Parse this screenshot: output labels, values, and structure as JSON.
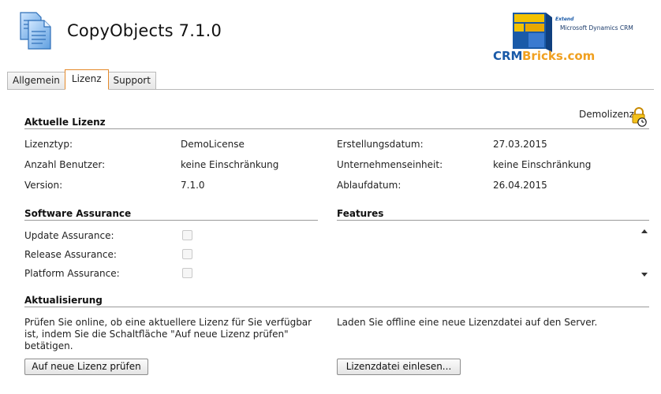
{
  "app": {
    "title": "CopyObjects 7.1.0",
    "icon": "document-copy-icon"
  },
  "brand": {
    "extend": "Extend",
    "product": "Microsoft Dynamics CRM",
    "name_a": "CRM",
    "name_b": "Bricks.com"
  },
  "tabs": [
    {
      "label": "Allgemein",
      "active": false
    },
    {
      "label": "Lizenz",
      "active": true
    },
    {
      "label": "Support",
      "active": false
    }
  ],
  "license": {
    "badge": "Demolizenz",
    "title": "Aktuelle Lizenz",
    "rows": [
      {
        "label": "Lizenztyp:",
        "value": "DemoLicense",
        "label2": "Erstellungsdatum:",
        "value2": "27.03.2015"
      },
      {
        "label": "Anzahl Benutzer:",
        "value": "keine Einschränkung",
        "label2": "Unternehmenseinheit:",
        "value2": "keine Einschränkung"
      },
      {
        "label": "Version:",
        "value": "7.1.0",
        "label2": "Ablaufdatum:",
        "value2": "26.04.2015"
      }
    ]
  },
  "assurance": {
    "title": "Software Assurance",
    "items": [
      {
        "label": "Update Assurance:",
        "checked": false
      },
      {
        "label": "Release Assurance:",
        "checked": false
      },
      {
        "label": "Platform Assurance:",
        "checked": false
      }
    ]
  },
  "features": {
    "title": "Features"
  },
  "update": {
    "title": "Aktualisierung",
    "online_text": "Prüfen Sie online, ob eine aktuellere Lizenz für Sie verfügbar ist, indem Sie die Schaltfläche \"Auf neue Lizenz prüfen\" betätigen.",
    "offline_text": "Laden Sie offline eine neue Lizenzdatei auf den Server.",
    "check_button": "Auf neue Lizenz prüfen",
    "load_button": "Lizenzdatei einlesen..."
  },
  "colors": {
    "active_tab_border": "#e58a2b",
    "brand_blue": "#1a5aa8",
    "brand_orange": "#f0a020"
  }
}
